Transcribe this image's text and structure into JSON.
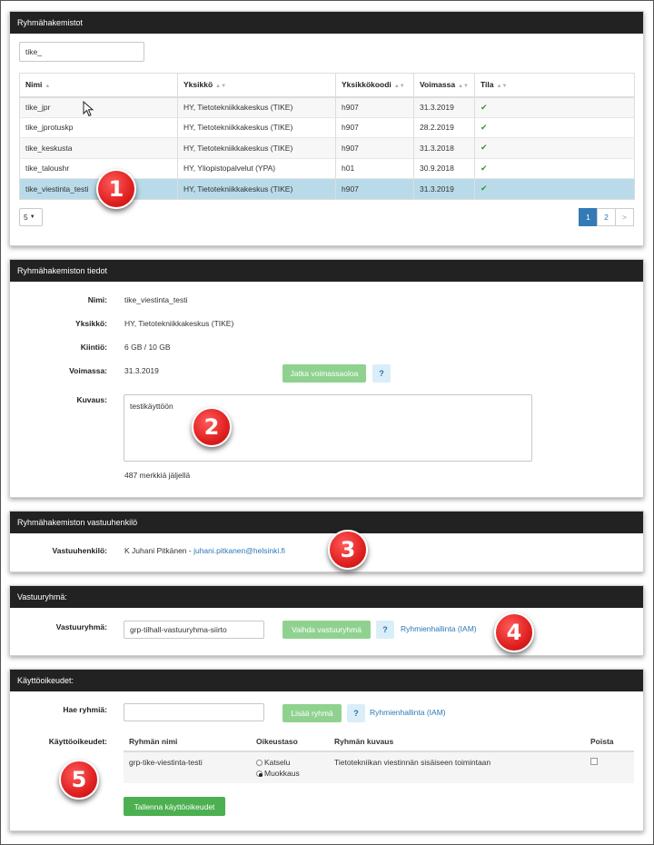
{
  "panel1": {
    "title": "Ryhmähakemistot",
    "search_value": "tike_",
    "columns": [
      "Nimi",
      "Yksikkö",
      "Yksikkökoodi",
      "Voimassa",
      "Tila"
    ],
    "rows": [
      {
        "name": "tike_jpr",
        "unit": "HY, Tietotekniikkakeskus (TIKE)",
        "code": "h907",
        "valid": "31.3.2019"
      },
      {
        "name": "tike_jprotuskp",
        "unit": "HY, Tietotekniikkakeskus (TIKE)",
        "code": "h907",
        "valid": "28.2.2019"
      },
      {
        "name": "tike_keskusta",
        "unit": "HY, Tietotekniikkakeskus (TIKE)",
        "code": "h907",
        "valid": "31.3.2018"
      },
      {
        "name": "tike_taloushr",
        "unit": "HY, Yliopistopalvelut (YPA)",
        "code": "h01",
        "valid": "30.9.2018"
      },
      {
        "name": "tike_viestinta_testi",
        "unit": "HY, Tietotekniikkakeskus (TIKE)",
        "code": "h907",
        "valid": "31.3.2019"
      }
    ],
    "page_size": "5",
    "pages": [
      "1",
      "2",
      ">"
    ]
  },
  "panel2": {
    "title": "Ryhmähakemiston tiedot",
    "name_label": "Nimi:",
    "name_value": "tike_viestinta_testi",
    "unit_label": "Yksikkö:",
    "unit_value": "HY, Tietotekniikkakeskus (TIKE)",
    "quota_label": "Kiintiö:",
    "quota_value": "6 GB / 10 GB",
    "valid_label": "Voimassa:",
    "valid_value": "31.3.2019",
    "extend_button": "Jatka voimassaoloa",
    "help": "?",
    "desc_label": "Kuvaus:",
    "desc_value": "testikäyttöön",
    "chars_left": "487 merkkiä jäljellä"
  },
  "panel3": {
    "title": "Ryhmähakemiston vastuuhenkilö",
    "label": "Vastuuhenkilö:",
    "person": "K Juhani Pitkänen - ",
    "email": "juhani.pitkanen@helsinki.fi"
  },
  "panel4": {
    "title": "Vastuuryhmä:",
    "label": "Vastuuryhmä:",
    "value": "grp-tilhall-vastuuryhma-siirto",
    "change_button": "Vaihda vastuuryhmä",
    "help": "?",
    "link": "Ryhmienhallinta (IAM)"
  },
  "panel5": {
    "title": "Käyttöoikeudet:",
    "search_label": "Hae ryhmiä:",
    "add_button": "Lisää ryhmä",
    "help": "?",
    "link": "Ryhmienhallinta (IAM)",
    "perm_label": "Käyttöoikeudet:",
    "columns": [
      "Ryhmän nimi",
      "Oikeustaso",
      "Ryhmän kuvaus",
      "Poista"
    ],
    "row": {
      "group": "grp-tike-viestinta-testi",
      "option_view": "Katselu",
      "option_edit": "Muokkaus",
      "description": "Tietotekniikan viestinnän sisäiseen toimintaan"
    },
    "save_button": "Tallenna käyttöoikeudet"
  },
  "badges": [
    "1",
    "2",
    "3",
    "4",
    "5"
  ],
  "colors": {
    "header": "#222222",
    "selected_row": "#b9dbe9",
    "green": "#4caf50",
    "link": "#2a77b8"
  }
}
